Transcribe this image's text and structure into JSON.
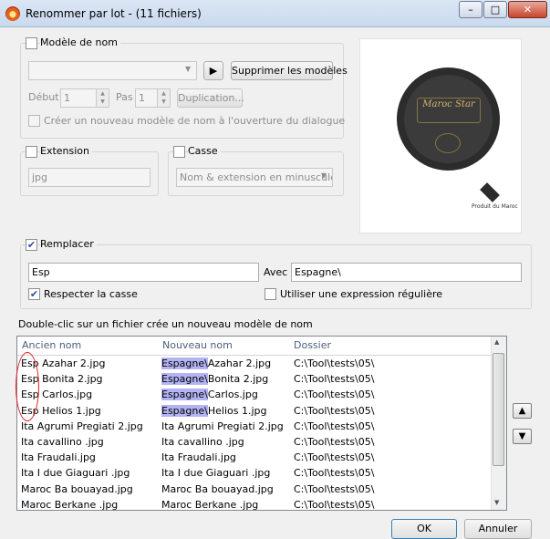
{
  "window": {
    "title": "Renommer par lot - (11 fichiers)",
    "minimize": "–",
    "maximize": "□",
    "close": "✕",
    "icon": "app-flame-icon"
  },
  "name_model": {
    "label": "Modèle de nom",
    "checked": false,
    "combo_value": "",
    "play_icon": "play-icon",
    "delete_models_label": "Supprimer les modèles",
    "start_label": "Début",
    "start_value": "1",
    "step_label": "Pas",
    "step_value": "1",
    "duplication_label": "Duplication...",
    "create_model_label": "Créer un nouveau modèle de nom à l'ouverture du dialogue"
  },
  "extension": {
    "label": "Extension",
    "value": "jpg"
  },
  "case": {
    "label": "Casse",
    "value": "Nom & extension en minuscule"
  },
  "preview": {
    "brand": "Maroc Star",
    "corner_text": "Produit du Maroc"
  },
  "replace": {
    "label": "Remplacer",
    "checked": true,
    "find_value": "Esp",
    "with_label": "Avec",
    "with_value": "Espagne\\",
    "match_case_label": "Respecter la casse",
    "regex_label": "Utiliser une expression régulière"
  },
  "hint": "Double-clic sur un fichier crée un nouveau modèle de nom",
  "table": {
    "columns": [
      "Ancien nom",
      "Nouveau nom",
      "Dossier"
    ],
    "rows": [
      {
        "old": "Esp Azahar 2.jpg",
        "new_hl": "Espagne\\",
        "new": "Azahar 2.jpg",
        "folder": "C:\\Tool\\tests\\05\\"
      },
      {
        "old": "Esp Bonita 2.jpg",
        "new_hl": "Espagne\\",
        "new": "Bonita 2.jpg",
        "folder": "C:\\Tool\\tests\\05\\"
      },
      {
        "old": "Esp Carlos.jpg",
        "new_hl": "Espagne\\",
        "new": "Carlos.jpg",
        "folder": "C:\\Tool\\tests\\05\\"
      },
      {
        "old": "Esp Helios 1.jpg",
        "new_hl": "Espagne\\",
        "new": "Helios 1.jpg",
        "folder": "C:\\Tool\\tests\\05\\"
      },
      {
        "old": "Ita Agrumi Pregiati 2.jpg",
        "new_hl": "",
        "new": "Ita Agrumi Pregiati 2.jpg",
        "folder": "C:\\Tool\\tests\\05\\"
      },
      {
        "old": "Ita cavallino .jpg",
        "new_hl": "",
        "new": "Ita cavallino .jpg",
        "folder": "C:\\Tool\\tests\\05\\"
      },
      {
        "old": "Ita Fraudali.jpg",
        "new_hl": "",
        "new": "Ita Fraudali.jpg",
        "folder": "C:\\Tool\\tests\\05\\"
      },
      {
        "old": "Ita I due Giaguari .jpg",
        "new_hl": "",
        "new": "Ita I due Giaguari .jpg",
        "folder": "C:\\Tool\\tests\\05\\"
      },
      {
        "old": "Maroc Ba bouayad.jpg",
        "new_hl": "",
        "new": "Maroc Ba bouayad.jpg",
        "folder": "C:\\Tool\\tests\\05\\"
      },
      {
        "old": "Maroc Berkane .jpg",
        "new_hl": "",
        "new": "Maroc Berkane .jpg",
        "folder": "C:\\Tool\\tests\\05\\"
      }
    ]
  },
  "move_up_icon": "arrow-up-icon",
  "move_down_icon": "arrow-down-icon",
  "ok_label": "OK",
  "cancel_label": "Annuler"
}
